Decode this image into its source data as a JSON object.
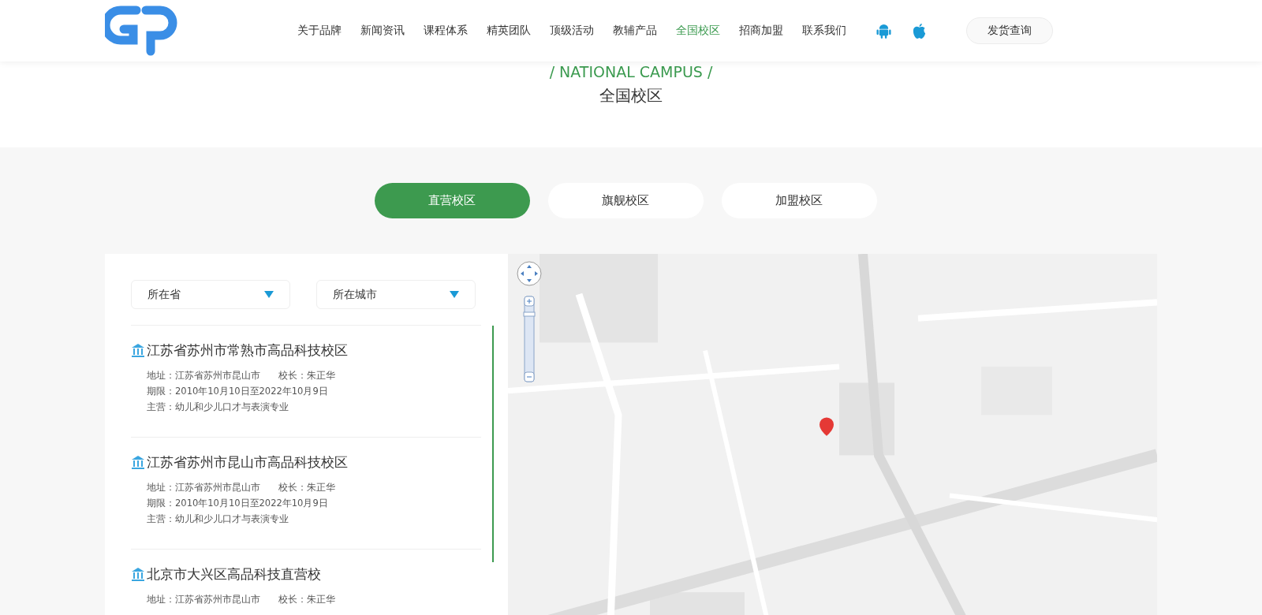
{
  "header": {
    "nav": [
      {
        "label": "关于品牌",
        "selected": false
      },
      {
        "label": "新闻资讯",
        "selected": false
      },
      {
        "label": "课程体系",
        "selected": false
      },
      {
        "label": "精英团队",
        "selected": false
      },
      {
        "label": "顶级活动",
        "selected": false
      },
      {
        "label": "教辅产品",
        "selected": false
      },
      {
        "label": "全国校区",
        "selected": true
      },
      {
        "label": "招商加盟",
        "selected": false
      },
      {
        "label": "联系我们",
        "selected": false
      }
    ],
    "query_button": "发货查询"
  },
  "section": {
    "subtitle": "/ NATIONAL CAMPUS /",
    "title": "全国校区"
  },
  "tabs": [
    {
      "label": "直营校区",
      "selected": true
    },
    {
      "label": "旗舰校区",
      "selected": false
    },
    {
      "label": "加盟校区",
      "selected": false
    }
  ],
  "filters": [
    {
      "placeholder": "所在省"
    },
    {
      "placeholder": "所在城市"
    }
  ],
  "campuses": [
    {
      "name": "江苏省苏州市常熟市高品科技校区",
      "address": "地址：江苏省苏州市昆山市",
      "principal": "校长：朱正华",
      "period": "期限：2010年10月10日至2022年10月9日",
      "business": "主营：幼儿和少儿口才与表演专业"
    },
    {
      "name": "江苏省苏州市昆山市高品科技校区",
      "address": "地址：江苏省苏州市昆山市",
      "principal": "校长：朱正华",
      "period": "期限：2010年10月10日至2022年10月9日",
      "business": "主营：幼儿和少儿口才与表演专业"
    },
    {
      "name": "北京市大兴区高品科技直营校",
      "address": "地址：江苏省苏州市昆山市",
      "principal": "校长：朱正华"
    }
  ]
}
